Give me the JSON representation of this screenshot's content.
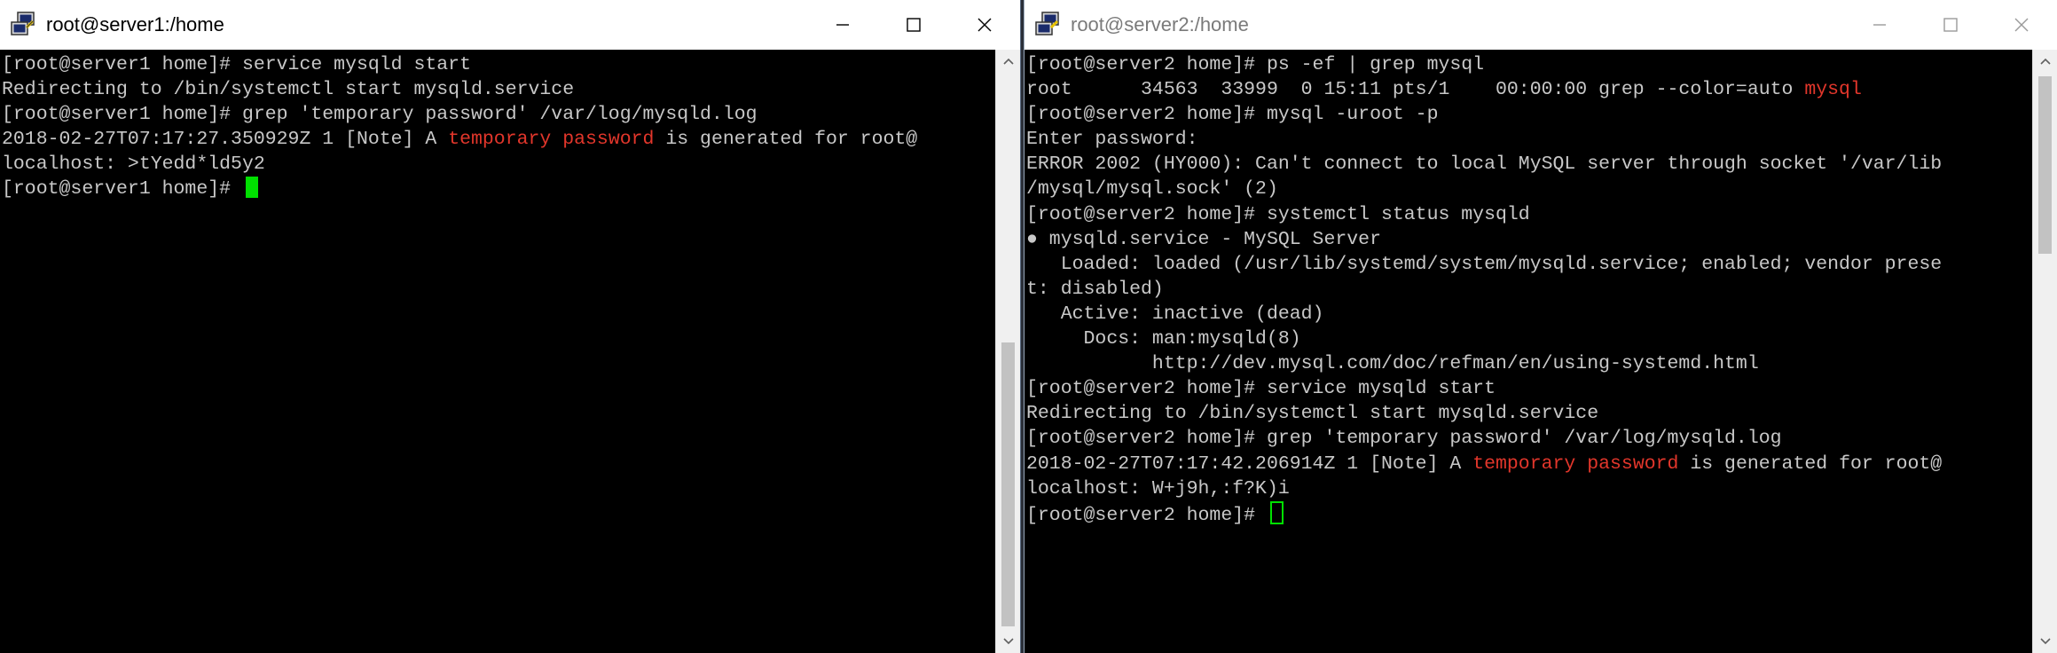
{
  "windows": {
    "server1": {
      "title": "root@server1:/home",
      "lines": [
        [
          {
            "t": "[root@server1 home]# service mysqld start"
          }
        ],
        [
          {
            "t": "Redirecting to /bin/systemctl start mysqld.service"
          }
        ],
        [
          {
            "t": "[root@server1 home]# grep 'temporary password' /var/log/mysqld.log"
          }
        ],
        [
          {
            "t": "2018-02-27T07:17:27.350929Z 1 [Note] A "
          },
          {
            "t": "temporary password",
            "hl": true
          },
          {
            "t": " is generated for root@"
          }
        ],
        [
          {
            "t": "localhost: >tYedd*ld5y2"
          }
        ],
        [
          {
            "t": "[root@server1 home]# "
          }
        ]
      ]
    },
    "server2": {
      "title": "root@server2:/home",
      "lines": [
        [
          {
            "t": "[root@server2 home]# ps -ef | grep mysql"
          }
        ],
        [
          {
            "t": "root      34563  33999  0 15:11 pts/1    00:00:00 grep --color=auto "
          },
          {
            "t": "mysql",
            "hl": true
          }
        ],
        [
          {
            "t": "[root@server2 home]# mysql -uroot -p"
          }
        ],
        [
          {
            "t": "Enter password:"
          }
        ],
        [
          {
            "t": "ERROR 2002 (HY000): Can't connect to local MySQL server through socket '/var/lib"
          }
        ],
        [
          {
            "t": "/mysql/mysql.sock' (2)"
          }
        ],
        [
          {
            "t": "[root@server2 home]# systemctl status mysqld"
          }
        ],
        [
          {
            "t": "● mysqld.service - MySQL Server"
          }
        ],
        [
          {
            "t": "   Loaded: loaded (/usr/lib/systemd/system/mysqld.service; enabled; vendor prese"
          }
        ],
        [
          {
            "t": "t: disabled)"
          }
        ],
        [
          {
            "t": "   Active: inactive (dead)"
          }
        ],
        [
          {
            "t": "     Docs: man:mysqld(8)"
          }
        ],
        [
          {
            "t": "           http://dev.mysql.com/doc/refman/en/using-systemd.html"
          }
        ],
        [
          {
            "t": "[root@server2 home]# service mysqld start"
          }
        ],
        [
          {
            "t": "Redirecting to /bin/systemctl start mysqld.service"
          }
        ],
        [
          {
            "t": "[root@server2 home]# grep 'temporary password' /var/log/mysqld.log"
          }
        ],
        [
          {
            "t": "2018-02-27T07:17:42.206914Z 1 [Note] A "
          },
          {
            "t": "temporary password",
            "hl": true
          },
          {
            "t": " is generated for root@"
          }
        ],
        [
          {
            "t": "localhost: W+j9h,:f?K)i"
          }
        ],
        [
          {
            "t": "[root@server2 home]# "
          }
        ]
      ]
    }
  },
  "icons": {
    "app": "putty-icon",
    "minimize": "minimize-icon",
    "maximize": "maximize-icon",
    "close": "close-icon"
  },
  "colors": {
    "terminal_bg": "#000000",
    "terminal_fg": "#c8c8c8",
    "highlight": "#e2362b",
    "cursor": "#00e000"
  }
}
